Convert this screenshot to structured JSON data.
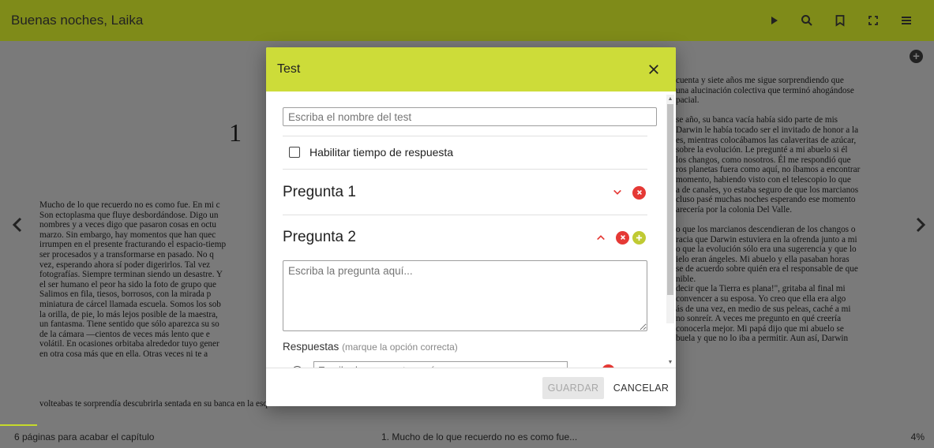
{
  "app": {
    "title": "Buenas noches, Laika",
    "toolbar_icons": [
      "play-icon",
      "search-icon",
      "bookmark-icon",
      "fullscreen-icon",
      "menu-icon"
    ]
  },
  "reader": {
    "chapter_number": "1",
    "left_column": [
      "Mucho de lo que recuerdo no es como fue. En mi c",
      "Son ectoplasma que fluye desbordándose. Digo un",
      "nombres y a veces digo que pasaron cosas en octu",
      "marzo. Sin embargo, hay momentos que han quec",
      "irrumpen en el presente fracturando el espacio-tiemp",
      "ser procesados y a transformarse en pasado. No q",
      "vez, esperando ahora sí poder digerirlos. Tal vez",
      "fotografías. Siempre terminan siendo un desastre. Y",
      "el ser humano el peor ha sido la foto de grupo que",
      "Salimos en fila, tiesos, borrosos, con la mirada p",
      "miniatura de cárcel llamada escuela. Somos los sob",
      "la orilla, de pie, lo más lejos posible de la maestra,",
      "un fantasma. Tiene sentido que sólo aparezca su so",
      "de la cámara —cientos de veces más lento que e",
      "volátil. En ocasiones orbitaba alrededor tuyo gener",
      "en otra cosa más que en ella. Otras veces ni te a"
    ],
    "left_tail": "volteabas te sorprendía descubrirla sentada en su banca en la esquina del salón. Era como",
    "right_column": [
      "cuenta y siete años me sigue sorprendiendo que",
      "una alucinación colectiva que terminó ahogándose",
      "pacial.",
      "",
      "se año, su banca vacía había sido parte de mis",
      "Darwin le había tocado ser el invitado de honor a la",
      "es, mientras colocábamos las calaveritas de azúcar,",
      "sobre la evolución. Le pregunté a mi abuelo si él",
      "los changos, como nosotros. Él me respondió que",
      "ros planetas fuera como aquí, no íbamos a encontrar",
      "momento, habiendo visto con el telescopio lo que",
      "a de canales, yo estaba seguro de que los marcianos",
      "cluso pasé muchas noches esperando ese momento",
      "arecería por la colonia Del Valle.",
      "",
      "o que los marcianos descendieran de los changos o",
      "racia que Darwin estuviera en la ofrenda junto a mi",
      "o que la evolución sólo era una sugerencia y que lo",
      "ielo eran ángeles. Mi abuelo y ella pasaban horas",
      "se de acuerdo sobre quién era el responsable de que",
      "nible.",
      "decir que la Tierra es plana!\", gritaba al final mi",
      "convencer a su esposa. Yo creo que ella era algo",
      "ás de una vez, en medio de sus peleas, caché a mi",
      "no sonreír. A veces me pregunto en qué creería",
      "conocerla mejor. Mi papá dijo que mi abuelo se",
      "buela y que no lo iba a permitir. Aun así, Darwin"
    ]
  },
  "footer": {
    "pages_left": "6 páginas para acabar el capítulo",
    "chapter": "1. Mucho de lo que recuerdo no es como fue...",
    "percent": "4%",
    "progress": 0.04
  },
  "modal": {
    "title": "Test",
    "name_placeholder": "Escriba el nombre del test",
    "timer_label": "Habilitar tiempo de respuesta",
    "question1_label": "Pregunta 1",
    "question2_label": "Pregunta 2",
    "question_placeholder": "Escriba la pregunta aquí...",
    "answers_label": "Respuestas",
    "answers_hint": "(marque la opción correcta)",
    "answer_placeholder": "Escriba la respuesta aquí...",
    "save_label": "GUARDAR",
    "cancel_label": "CANCELAR"
  },
  "colors": {
    "header": "#7f8b19",
    "modal_header": "#cddc39",
    "delete": "#e53935",
    "add": "#c0ca33"
  }
}
